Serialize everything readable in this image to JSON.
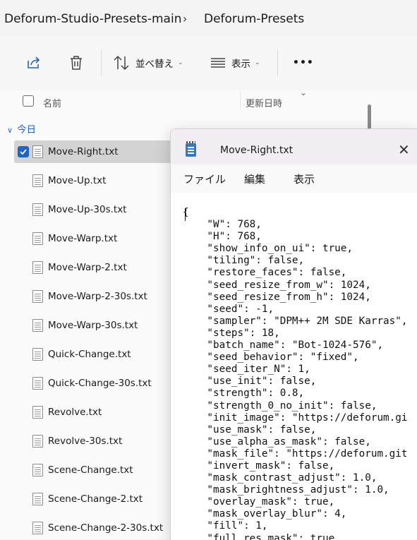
{
  "breadcrumb": [
    "Deforum-Studio-Presets-main",
    "Deforum-Presets"
  ],
  "toolbar": {
    "share_icon": "share-icon",
    "delete_icon": "trash-icon",
    "sort_label": "並べ替え",
    "view_label": "表示",
    "more_label": "•••"
  },
  "columns": {
    "name": "名前",
    "modified": "更新日時"
  },
  "group_label": "今日",
  "files": [
    "Move-Right.txt",
    "Move-Up.txt",
    "Move-Up-30s.txt",
    "Move-Warp.txt",
    "Move-Warp-2.txt",
    "Move-Warp-2-30s.txt",
    "Move-Warp-30s.txt",
    "Quick-Change.txt",
    "Quick-Change-30s.txt",
    "Revolve.txt",
    "Revolve-30s.txt",
    "Scene-Change.txt",
    "Scene-Change-2.txt",
    "Scene-Change-2-30s.txt"
  ],
  "notepad": {
    "title": "Move-Right.txt",
    "close": "✕",
    "menu": [
      "ファイル",
      "編集",
      "表示"
    ],
    "content": "{\n    \"W\": 768,\n    \"H\": 768,\n    \"show_info_on_ui\": true,\n    \"tiling\": false,\n    \"restore_faces\": false,\n    \"seed_resize_from_w\": 1024,\n    \"seed_resize_from_h\": 1024,\n    \"seed\": -1,\n    \"sampler\": \"DPM++ 2M SDE Karras\",\n    \"steps\": 18,\n    \"batch_name\": \"Bot-1024-576\",\n    \"seed_behavior\": \"fixed\",\n    \"seed_iter_N\": 1,\n    \"use_init\": false,\n    \"strength\": 0.8,\n    \"strength_0_no_init\": false,\n    \"init_image\": \"https://deforum.gi\n    \"use_mask\": false,\n    \"use_alpha_as_mask\": false,\n    \"mask_file\": \"https://deforum.git\n    \"invert_mask\": false,\n    \"mask_contrast_adjust\": 1.0,\n    \"mask_brightness_adjust\": 1.0,\n    \"overlay_mask\": true,\n    \"mask_overlay_blur\": 4,\n    \"fill\": 1,\n    \"full_res_mask\": true"
  }
}
